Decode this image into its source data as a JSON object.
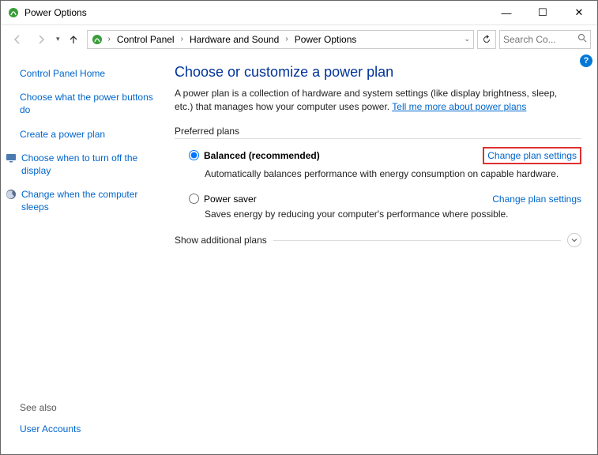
{
  "window": {
    "title": "Power Options",
    "minimize": "—",
    "maximize": "☐",
    "close": "✕"
  },
  "nav": {
    "breadcrumb": {
      "root": "Control Panel",
      "mid": "Hardware and Sound",
      "leaf": "Power Options"
    },
    "search_placeholder": "Search Co..."
  },
  "sidebar": {
    "home": "Control Panel Home",
    "link1": "Choose what the power buttons do",
    "link2": "Create a power plan",
    "link3": "Choose when to turn off the display",
    "link4": "Change when the computer sleeps",
    "seealso": "See also",
    "seealso1": "User Accounts"
  },
  "main": {
    "title": "Choose or customize a power plan",
    "desc_pre": "A power plan is a collection of hardware and system settings (like display brightness, sleep, etc.) that manages how your computer uses power. ",
    "desc_link": "Tell me more about power plans",
    "preferred_label": "Preferred plans",
    "plan1": {
      "name": "Balanced (recommended)",
      "link": "Change plan settings",
      "desc": "Automatically balances performance with energy consumption on capable hardware."
    },
    "plan2": {
      "name": "Power saver",
      "link": "Change plan settings",
      "desc": "Saves energy by reducing your computer's performance where possible."
    },
    "show_more": "Show additional plans"
  }
}
